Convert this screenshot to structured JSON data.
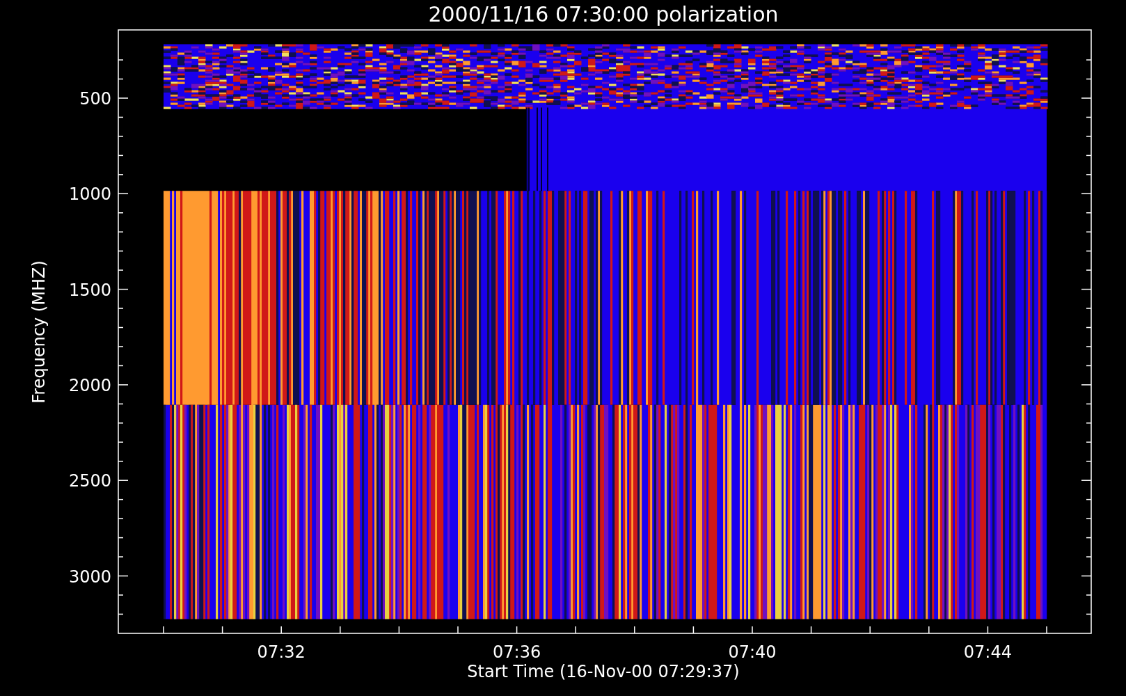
{
  "title": "2000/11/16 07:30:00 polarization",
  "plot": {
    "ylabel": "Frequency (MHZ)",
    "xlabel": "Start Time (16-Nov-00 07:29:37)",
    "yticks": [
      "500",
      "1000",
      "1500",
      "2000",
      "2500",
      "3000"
    ],
    "xticks": [
      "07:32",
      "07:36",
      "07:40",
      "07:44"
    ]
  }
}
